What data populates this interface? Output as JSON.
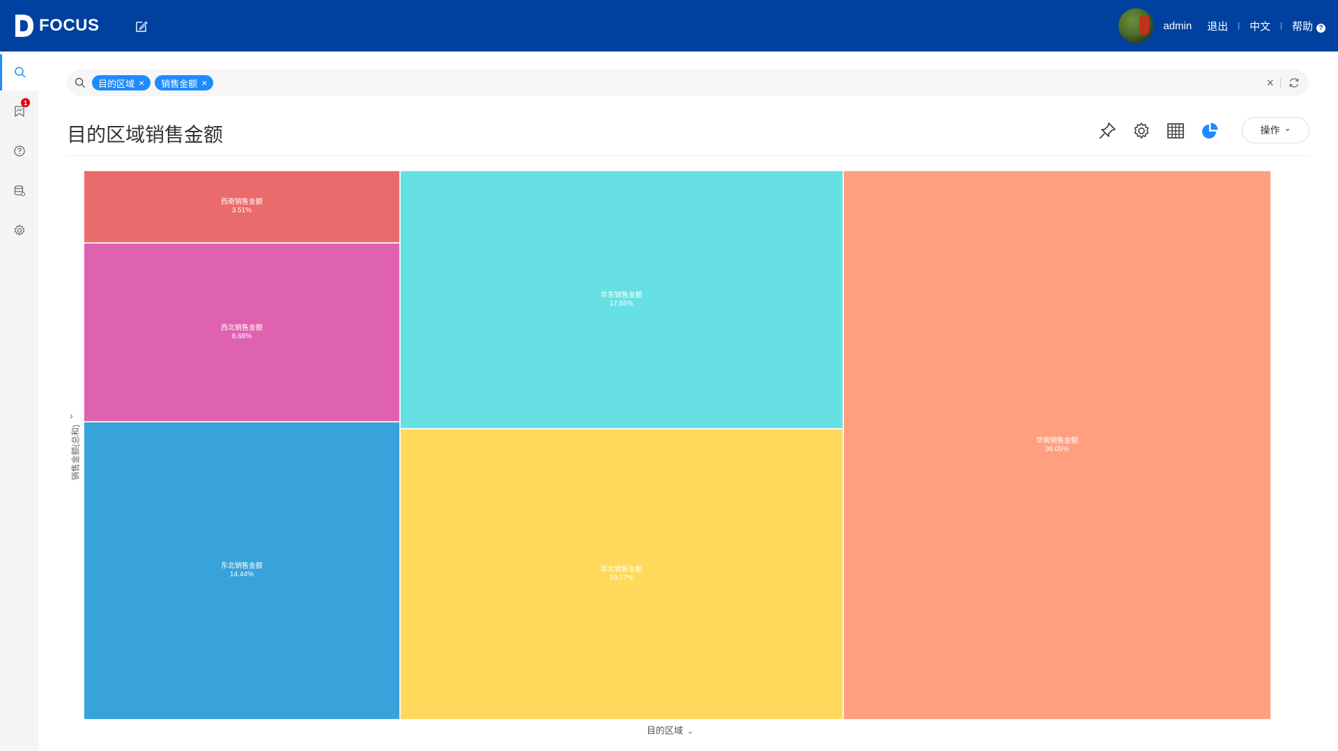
{
  "app": {
    "logo_text": "FOCUS",
    "brand_color": "#0041a0",
    "accent_color": "#1e8bff"
  },
  "header": {
    "username": "admin",
    "logout": "退出",
    "language": "中文",
    "help": "帮助",
    "help_icon": "?"
  },
  "sidebar": {
    "items": [
      {
        "icon": "search-icon",
        "active": true
      },
      {
        "icon": "bookmark-icon",
        "badge": "1"
      },
      {
        "icon": "help-icon"
      },
      {
        "icon": "database-icon"
      },
      {
        "icon": "settings-icon"
      }
    ]
  },
  "search": {
    "tokens": [
      {
        "label": "目的区域",
        "close": "×"
      },
      {
        "label": "销售金额",
        "close": "×"
      }
    ],
    "clear": "×"
  },
  "page": {
    "title": "目的区域销售金额",
    "operation_button": "操作",
    "operation_chevron": "⌄"
  },
  "chart_data": {
    "type": "treemap",
    "xlabel": "目的区域",
    "ylabel": "销售金额(总和)",
    "tiles": [
      {
        "label": "西南销售金额",
        "value_text": "3.51%",
        "value": 3.51,
        "color": "#ea6b6b"
      },
      {
        "label": "西北销售金额",
        "value_text": "8.68%",
        "value": 8.68,
        "color": "#df62ae"
      },
      {
        "label": "东北销售金额",
        "value_text": "14.44%",
        "value": 14.44,
        "color": "#38a2da"
      },
      {
        "label": "华东销售金额",
        "value_text": "17.55%",
        "value": 17.55,
        "color": "#66e0e3"
      },
      {
        "label": "华北销售金额",
        "value_text": "19.77%",
        "value": 19.77,
        "color": "#fed95c"
      },
      {
        "label": "华南销售金额",
        "value_text": "36.05%",
        "value": 36.05,
        "color": "#ff9f7f"
      }
    ]
  }
}
